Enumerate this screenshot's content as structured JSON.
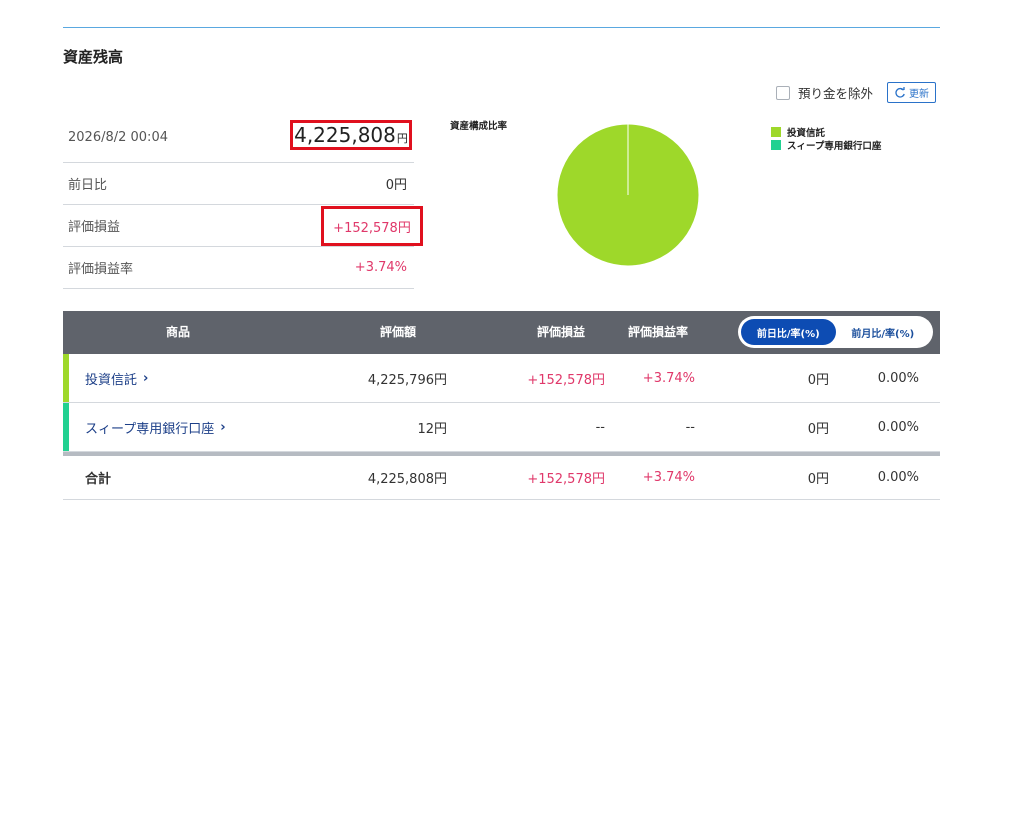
{
  "section_title": "資産残高",
  "controls": {
    "exclude_deposit_label": "預り金を除外",
    "refresh_label": "更新"
  },
  "summary": {
    "datetime": "2026/8/2 00:04",
    "total_number": "4,225,808",
    "total_unit": "円",
    "rows": [
      {
        "label": "前日比",
        "value": "0円"
      },
      {
        "label": "評価損益",
        "value": "+152,578円"
      },
      {
        "label": "評価損益率",
        "value": "+3.74%"
      }
    ]
  },
  "chart_data": {
    "type": "pie",
    "title": "資産構成比率",
    "labels": [
      "投資信託",
      "スィープ専用銀行口座"
    ],
    "values": [
      4225796,
      12
    ],
    "colors": [
      "#9ed82a",
      "#21d191"
    ],
    "legend_position": "right"
  },
  "table": {
    "headers": {
      "product": "商品",
      "valuation": "評価額",
      "profit": "評価損益",
      "profit_rate": "評価損益率"
    },
    "toggle": {
      "day": "前日比/率(%)",
      "month": "前月比/率(%)"
    },
    "rows": [
      {
        "name": "投資信託",
        "valuation": "4,225,796円",
        "profit": "+152,578円",
        "profit_rate": "+3.74%",
        "change": "0円",
        "change_rate": "0.00%",
        "color": "#9ed82a"
      },
      {
        "name": "スィープ専用銀行口座",
        "valuation": "12円",
        "profit": "--",
        "profit_rate": "--",
        "change": "0円",
        "change_rate": "0.00%",
        "color": "#21d191"
      }
    ],
    "total": {
      "name": "合計",
      "valuation": "4,225,808円",
      "profit": "+152,578円",
      "profit_rate": "+3.74%",
      "change": "0円",
      "change_rate": "0.00%"
    }
  }
}
